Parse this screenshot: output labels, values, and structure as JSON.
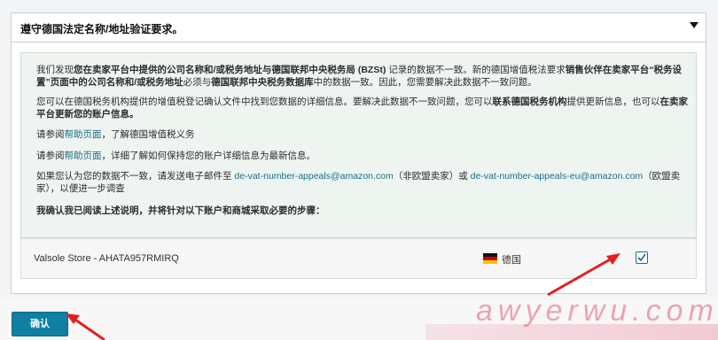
{
  "header": {
    "title": "遵守德国法定名称/地址验证要求。"
  },
  "notice": {
    "p1": {
      "a": "我们发现",
      "b": "您在卖家平台中提供的公司名称和/或税务地址与德国联邦中央税务局 (BZSt)",
      "c": " 记录的数据不一致。新的德国增值税法要求",
      "d": "销售伙伴在卖家平台“税务设置”页面中的公司名称和/或税务地址",
      "e": "必须与",
      "f": "德国联邦中央税务数据库",
      "g": "中的数据一致。因此，您需要解决此数据不一致问题。"
    },
    "p2": {
      "a": "您可以在德国税务机构提供的增值税登记确认文件中找到您数据的详细信息。要解决此数据不一致问题，您可以",
      "b": "联系德国税务机构",
      "c": "提供更新信息，也可以",
      "d": "在卖家平台更新您的账户信息。"
    },
    "p3": {
      "a": "请参阅",
      "link": "帮助页面",
      "b": "，了解德国增值税义务"
    },
    "p4": {
      "a": "请参阅",
      "link": "帮助页面",
      "b": "，详细了解如何保持您的账户详细信息为最新信息。"
    },
    "p5": {
      "a": "如果您认为您的数据不一致，请发送电子邮件至 ",
      "email1": "de-vat-number-appeals@amazon.com",
      "b": "（非欧盟卖家）或 ",
      "email2": "de-vat-number-appeals-eu@amazon.com",
      "c": "（欧盟卖家），以便进一步调查"
    },
    "p6": "我确认我已阅读上述说明，并将针对以下账户和商城采取必要的步骤："
  },
  "store_row": {
    "store": "Valsole Store - AHATA957RMIRQ",
    "country": "德国",
    "checked": true
  },
  "footer": {
    "confirm_label": "确认"
  },
  "watermark": "awyerwu.com",
  "colors": {
    "accent": "#0f7fa2",
    "notice_bg": "#eef4f0",
    "arrow": "#e02020"
  }
}
